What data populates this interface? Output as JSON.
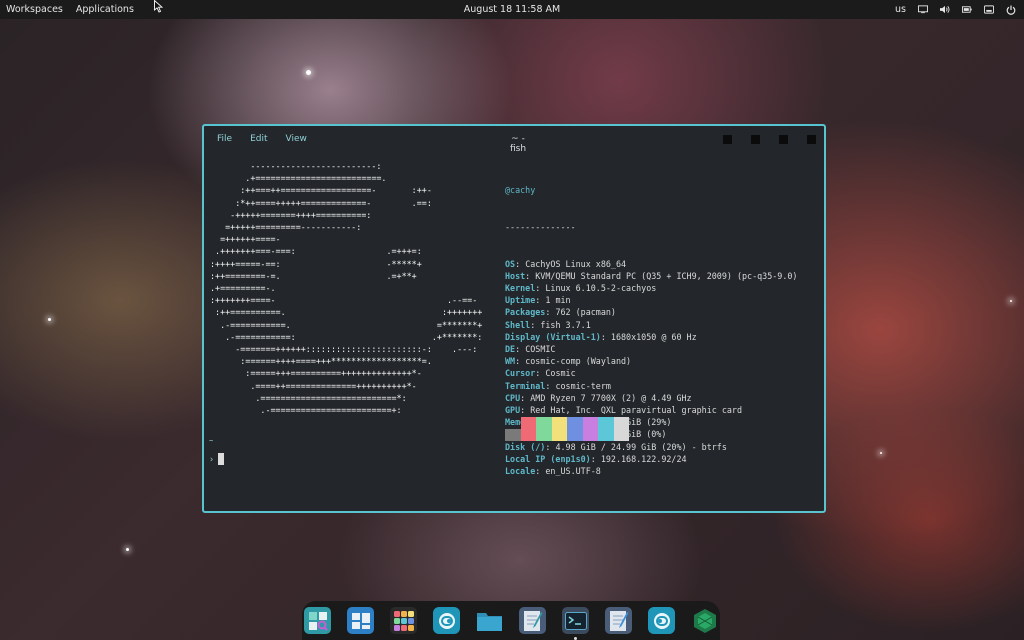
{
  "panel": {
    "workspaces": "Workspaces",
    "applications": "Applications",
    "clock": "August 18 11:58 AM",
    "keyboard_layout": "us",
    "icons": [
      "display-icon",
      "volume-icon",
      "battery-icon",
      "notifications-icon",
      "power-icon"
    ]
  },
  "window": {
    "menu": [
      "File",
      "Edit",
      "View"
    ],
    "title": "~ - fish"
  },
  "fastfetch": {
    "logo_lines": [
      "        -------------------------:",
      "       .+=========================.",
      "      :++===++==================-       :++-",
      "     :*++====+++++=============-        .==:",
      "    -+++++=======++++==========:",
      "   =+++++=========-----------:",
      "  =++++++====-",
      " .+++++++===-===:                  .=+++=:",
      ":++++=====-==:                     -*****+",
      ":++========-=.                     .=+**+",
      ".+=========-.",
      ":+++++++====-                                  .--==-",
      " :++==========.                               :+++++++",
      "  .-===========.                             =*******+",
      "   .-===========:                           .+*******:",
      "     -=======++++++:::::::::::::::::::::::-:    .---:",
      "      :======++++====+++******************=.",
      "       :=====+++==========++++++++++++++*-",
      "        .====++==============++++++++++*-",
      "         .===========================*:",
      "          .-========================+:"
    ],
    "header": "@cachy",
    "separator": "--------------",
    "rows": [
      {
        "key": "OS",
        "value": "CachyOS Linux x86_64"
      },
      {
        "key": "Host",
        "value": "KVM/QEMU Standard PC (Q35 + ICH9, 2009) (pc-q35-9.0)"
      },
      {
        "key": "Kernel",
        "value": "Linux 6.10.5-2-cachyos"
      },
      {
        "key": "Uptime",
        "value": "1 min"
      },
      {
        "key": "Packages",
        "value": "762 (pacman)"
      },
      {
        "key": "Shell",
        "value": "fish 3.7.1"
      },
      {
        "key": "Display (Virtual-1)",
        "value": "1680x1050 @ 60 Hz"
      },
      {
        "key": "DE",
        "value": "COSMIC"
      },
      {
        "key": "WM",
        "value": "cosmic-comp (Wayland)"
      },
      {
        "key": "Cursor",
        "value": "Cosmic"
      },
      {
        "key": "Terminal",
        "value": "cosmic-term"
      },
      {
        "key": "CPU",
        "value": "AMD Ryzen 7 7700X (2) @ 4.49 GHz"
      },
      {
        "key": "GPU",
        "value": "Red Hat, Inc. QXL paravirtual graphic card"
      },
      {
        "key": "Memory",
        "value": "1.11 GiB / 3.82 GiB (29%)"
      },
      {
        "key": "Swap",
        "value": "256.00 KiB / 3.82 GiB (0%)"
      },
      {
        "key": "Disk (/)",
        "value": "4.98 GiB / 24.99 GiB (20%) - btrfs"
      },
      {
        "key": "Local IP (enp1s0)",
        "value": "192.168.122.92/24"
      },
      {
        "key": "Locale",
        "value": "en_US.UTF-8"
      }
    ],
    "palette": [
      "#7a7a7a",
      "#ef6a74",
      "#7fd99a",
      "#f2e07a",
      "#6f8fe0",
      "#c97fe0",
      "#5cc7d6",
      "#d8d8d8"
    ]
  },
  "prompt": {
    "cwd": "~",
    "symbol": "›"
  },
  "dock": {
    "apps": [
      {
        "name": "app-finder",
        "color": "#3aa6b0"
      },
      {
        "name": "workspaces",
        "color": "#3d8fd6"
      },
      {
        "name": "app-library",
        "color": "#e0a03a"
      },
      {
        "name": "cosmic-store",
        "color": "#2fa7c7"
      },
      {
        "name": "files",
        "color": "#3a9ec6"
      },
      {
        "name": "text-editor",
        "color": "#5b6f8a"
      },
      {
        "name": "terminal",
        "color": "#32455a"
      },
      {
        "name": "text-editor-2",
        "color": "#5b6f8a"
      },
      {
        "name": "settings",
        "color": "#2fa7c7"
      },
      {
        "name": "cachyos-hello",
        "color": "#1e7a4a"
      }
    ]
  }
}
